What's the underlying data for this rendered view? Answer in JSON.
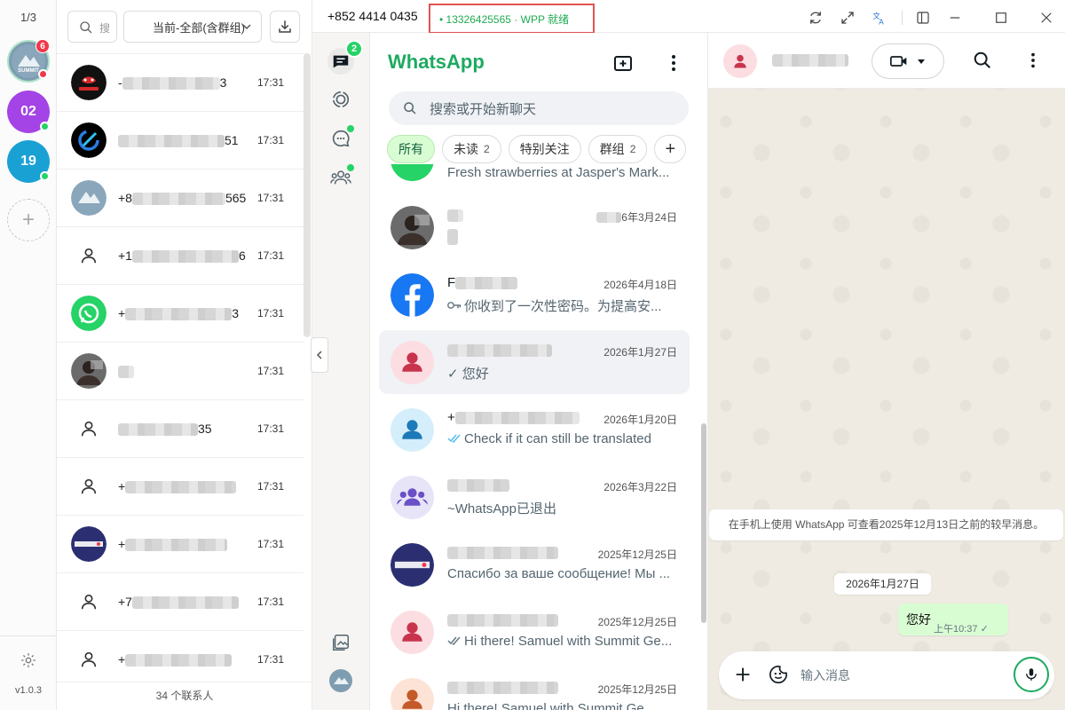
{
  "rail": {
    "pager": "1/3",
    "accounts": [
      {
        "label": "SUMMIT",
        "badge": "6",
        "status": "offline"
      },
      {
        "label": "02",
        "color": "#a443e6",
        "status": "online"
      },
      {
        "label": "19",
        "color": "#1aa1d4",
        "status": "online"
      }
    ],
    "add_label": "+",
    "version": "v1.0.3"
  },
  "contacts": {
    "search_placeholder": "搜",
    "filter_label": "当前-全部(含群组)",
    "rows": [
      {
        "prefix": "-",
        "suffix": "3",
        "time": "17:31",
        "avatar": "openclaw"
      },
      {
        "prefix": "",
        "suffix": "51",
        "time": "17:31",
        "avatar": "dark-logo"
      },
      {
        "prefix": "+8",
        "suffix": "565",
        "time": "17:31",
        "avatar": "summit"
      },
      {
        "prefix": "+1",
        "suffix": "6",
        "time": "17:31",
        "avatar": "person"
      },
      {
        "prefix": "+",
        "suffix": "3",
        "time": "17:31",
        "avatar": "whatsapp"
      },
      {
        "prefix": "",
        "suffix": "",
        "time": "17:31",
        "avatar": "photo"
      },
      {
        "prefix": "",
        "suffix": "35",
        "time": "17:31",
        "avatar": "person"
      },
      {
        "prefix": "+",
        "suffix": "",
        "time": "17:31",
        "avatar": "person"
      },
      {
        "prefix": "+",
        "suffix": "",
        "time": "17:31",
        "avatar": "almaherm"
      },
      {
        "prefix": "+7",
        "suffix": "",
        "time": "17:31",
        "avatar": "person"
      },
      {
        "prefix": "+",
        "suffix": "",
        "time": "17:31",
        "avatar": "person"
      }
    ],
    "count_label": "34 个联系人"
  },
  "topbar": {
    "phone": "+852 4414 0435",
    "status": "• 13326425565 · WPP 就绪"
  },
  "nav": {
    "chat_badge": "2"
  },
  "chats": {
    "brand": "WhatsApp",
    "search_placeholder": "搜索或开始新聊天",
    "chips": [
      {
        "label": "所有",
        "count": ""
      },
      {
        "label": "未读",
        "count": "2"
      },
      {
        "label": "特别关注",
        "count": ""
      },
      {
        "label": "群组",
        "count": "2"
      }
    ],
    "partial_message": "Fresh strawberries at Jasper's Mark...",
    "items": [
      {
        "name": "",
        "date": "6年3月24日",
        "message": "",
        "avatar": "photo"
      },
      {
        "name": "F",
        "date": "2026年4月18日",
        "message": "你收到了一次性密码。为提高安...",
        "avatar": "facebook",
        "icon": "key"
      },
      {
        "name": "",
        "date": "2026年1月27日",
        "message": "✓ 您好",
        "avatar": "person-pink",
        "selected": true
      },
      {
        "name": "+",
        "date": "2026年1月20日",
        "message": "Check if it can still be translated",
        "avatar": "person-blue",
        "icon": "double-check"
      },
      {
        "name": "",
        "date": "2026年3月22日",
        "message": "~WhatsApp已退出",
        "avatar": "group"
      },
      {
        "name": "",
        "date": "2025年12月25日",
        "message": "Спасибо за ваше сообщение! Мы ...",
        "avatar": "almaherm"
      },
      {
        "name": "",
        "date": "2025年12月25日",
        "message": "Hi there! Samuel with Summit Ge...",
        "avatar": "person-pink",
        "icon": "double-check-grey"
      },
      {
        "name": "",
        "date": "2025年12月25日",
        "message": "Hi there! Samuel with Summit Ge...",
        "avatar": "person-orange"
      }
    ]
  },
  "conversation": {
    "system_message": "在手机上使用 WhatsApp 可查看2025年12月13日之前的较早消息。",
    "date_chip": "2026年1月27日",
    "bubble_text": "您好",
    "bubble_time": "上午10:37 ✓",
    "composer_placeholder": "输入消息"
  },
  "colors": {
    "accent": "#1daa61",
    "badge": "#f0384a",
    "status_box": "#e05350"
  }
}
